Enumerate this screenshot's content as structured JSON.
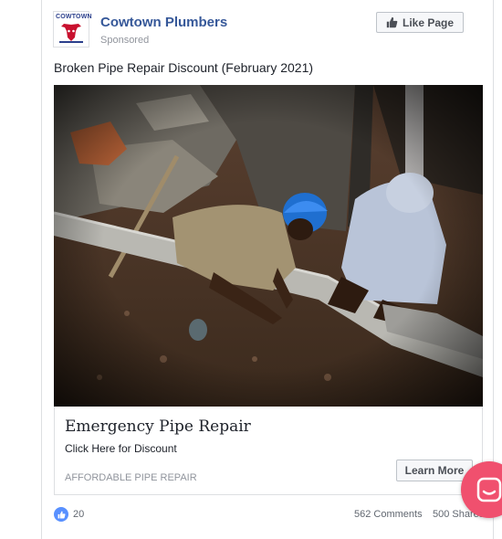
{
  "post": {
    "page_name": "Cowtown Plumbers",
    "sponsored": "Sponsored",
    "like_page_label": "Like Page",
    "text": "Broken Pipe Repair Discount (February 2021)"
  },
  "logo": {
    "text": "COWTOWN"
  },
  "link": {
    "title": "Emergency Pipe Repair",
    "description": "Click Here for Discount",
    "domain": "AFFORDABLE PIPE REPAIR",
    "cta_label": "Learn More"
  },
  "footer": {
    "likes": "20",
    "comments": "562 Comments",
    "shares": "500 Shares"
  },
  "colors": {
    "link_blue": "#365899",
    "like_blue": "#5890ff",
    "chat_pink": "#f0506e",
    "muted": "#90949c"
  },
  "icons": [
    "thumbs-up-icon",
    "chat-icon"
  ]
}
